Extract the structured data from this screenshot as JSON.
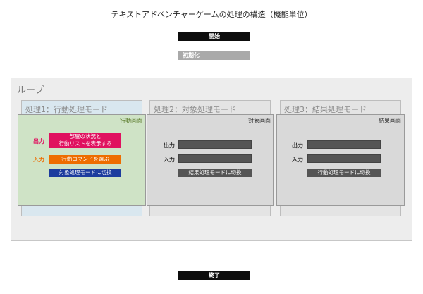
{
  "title": "テキストアドベンチャーゲームの処理の構造（機能単位）",
  "start_label": "開始",
  "init_label": "初期化",
  "end_label": "終了",
  "loop_label": "ループ",
  "panels": [
    {
      "title": "処理1：行動処理モード",
      "screen_label": "行動画面",
      "output_label": "出力",
      "output_text_line1": "部屋の状況と",
      "output_text_line2": "行動リストを表示する",
      "input_label": "入力",
      "input_text": "行動コマンドを選ぶ",
      "switch_text": "対象処理モードに切換"
    },
    {
      "title": "処理2：対象処理モード",
      "screen_label": "対象画面",
      "output_label": "出力",
      "input_label": "入力",
      "switch_text": "結果処理モードに切換"
    },
    {
      "title": "処理3：結果処理モード",
      "screen_label": "結果画面",
      "output_label": "出力",
      "input_label": "入力",
      "switch_text": "行動処理モードに切換"
    }
  ],
  "colors": {
    "output_box": "#e0115f",
    "input_box": "#ee6d00",
    "switch_box": "#1c3c9e",
    "active_screen": "#cfe3c6",
    "active_panel": "#d9e7ef",
    "inactive_screen": "#d9d9d9",
    "dark_field": "#555555"
  }
}
